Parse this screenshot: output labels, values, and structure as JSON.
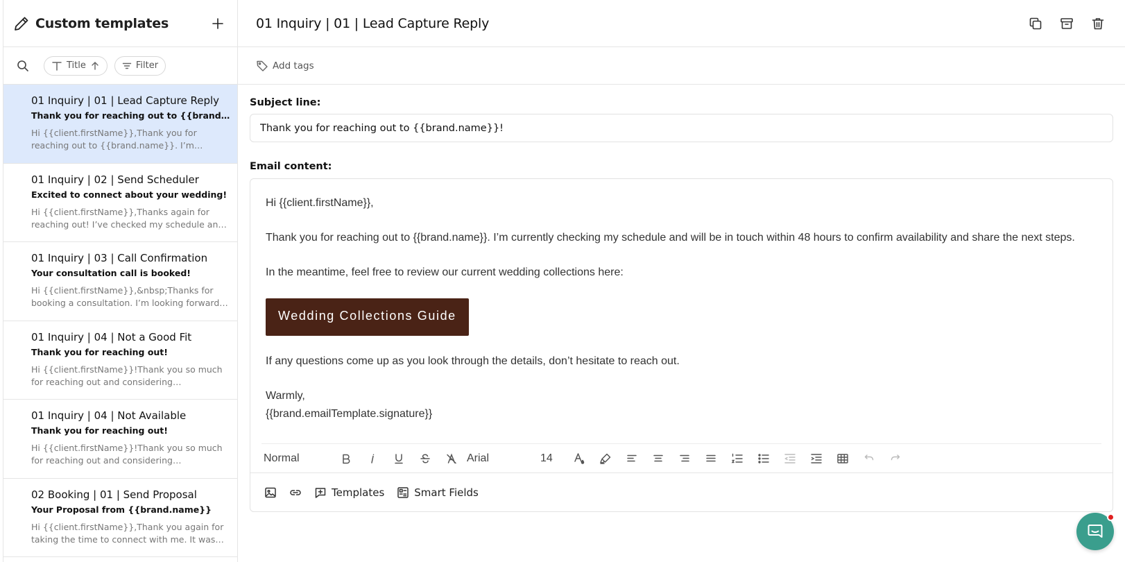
{
  "sidebar": {
    "title": "Custom templates",
    "sort_label": "Title",
    "filter_label": "Filter",
    "items": [
      {
        "title": "01 Inquiry | 01 | Lead Capture Reply",
        "subject": "Thank you for reaching out to {{brand.name}}!",
        "preview": "Hi {{client.firstName}},Thank you for reaching out to {{brand.name}}. I’m currently checking...",
        "active": true
      },
      {
        "title": "01 Inquiry | 02 | Send Scheduler",
        "subject": "Excited to connect about your wedding!",
        "preview": "Hi {{client.firstName}},Thanks again for reaching out! I’ve checked my schedule and I am...",
        "active": false
      },
      {
        "title": "01 Inquiry | 03 | Call Confirmation",
        "subject": "Your consultation call is booked!",
        "preview": "Hi {{client.firstName}},&nbsp;Thanks for booking a consultation. I’m looking forward t...",
        "active": false
      },
      {
        "title": "01 Inquiry | 04 | Not a Good Fit",
        "subject": "Thank you for reaching out!",
        "preview": "Hi {{client.firstName}}!Thank you so much for reaching out and considering {{brand.name}} ...",
        "active": false
      },
      {
        "title": "01 Inquiry | 04 | Not Available",
        "subject": "Thank you for reaching out!",
        "preview": "Hi {{client.firstName}}!Thank you so much for reaching out and considering {{brand.name}}...",
        "active": false
      },
      {
        "title": "02 Booking | 01 | Send Proposal",
        "subject": "Your Proposal from {{brand.name}}",
        "preview": "Hi {{client.firstName}},Thank you again for taking the time to connect with me. It was su...",
        "active": false
      }
    ]
  },
  "main": {
    "title": "01 Inquiry | 01 | Lead Capture Reply",
    "add_tags_label": "Add tags",
    "subject_label": "Subject line:",
    "subject_value": "Thank you for reaching out to {{brand.name}}!",
    "content_label": "Email content:",
    "email": {
      "greeting": "Hi {{client.firstName}},",
      "para1": "Thank you for reaching out to {{brand.name}}. I’m currently checking my schedule and will be in touch within 48 hours to confirm availability and share the next steps.",
      "para2": "In the meantime, feel free to review our current wedding collections here:",
      "cta_label": "Wedding Collections Guide",
      "cta_color": "#4a2316",
      "para3": "If any questions come up as you look through the details, don’t hesitate to reach out.",
      "signoff": "Warmly,",
      "signature": "{{brand.emailTemplate.signature}}"
    },
    "format_bar": {
      "block_style": "Normal",
      "font": "Arial",
      "size": "14"
    },
    "insert_bar": {
      "templates_label": "Templates",
      "smart_fields_label": "Smart Fields"
    }
  },
  "colors": {
    "active_item_bg": "#dde9fc",
    "chat_bg": "#3a9e8d",
    "notification_dot": "#e02020"
  }
}
